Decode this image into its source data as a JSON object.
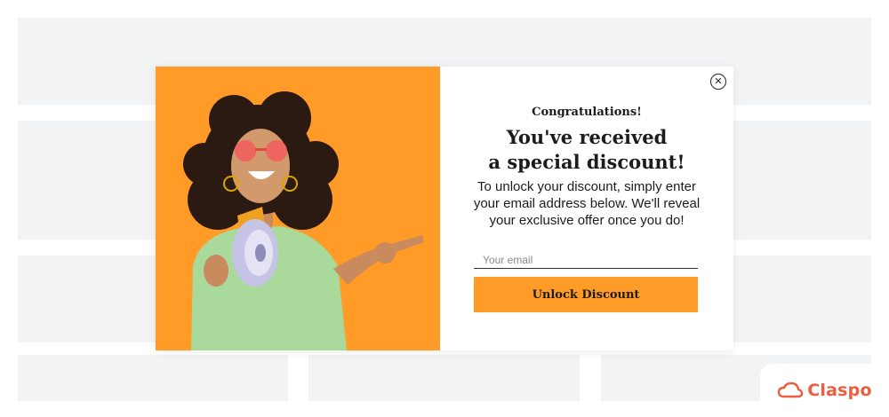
{
  "popup": {
    "eyebrow": "Congratulations!",
    "headline_line1": "You've received",
    "headline_line2": "a special discount!",
    "body_line1": "To unlock your discount, simply enter",
    "body_line2": "your email address below. We'll reveal",
    "body_line3": "your exclusive offer once you do!",
    "email_placeholder": "Your email",
    "button_label": "Unlock Discount",
    "close_icon": "close-icon",
    "accent_color": "#ff9b26"
  },
  "brand": {
    "name": "Claspo",
    "logo_icon": "cloud-icon",
    "color": "#ee5c42"
  }
}
